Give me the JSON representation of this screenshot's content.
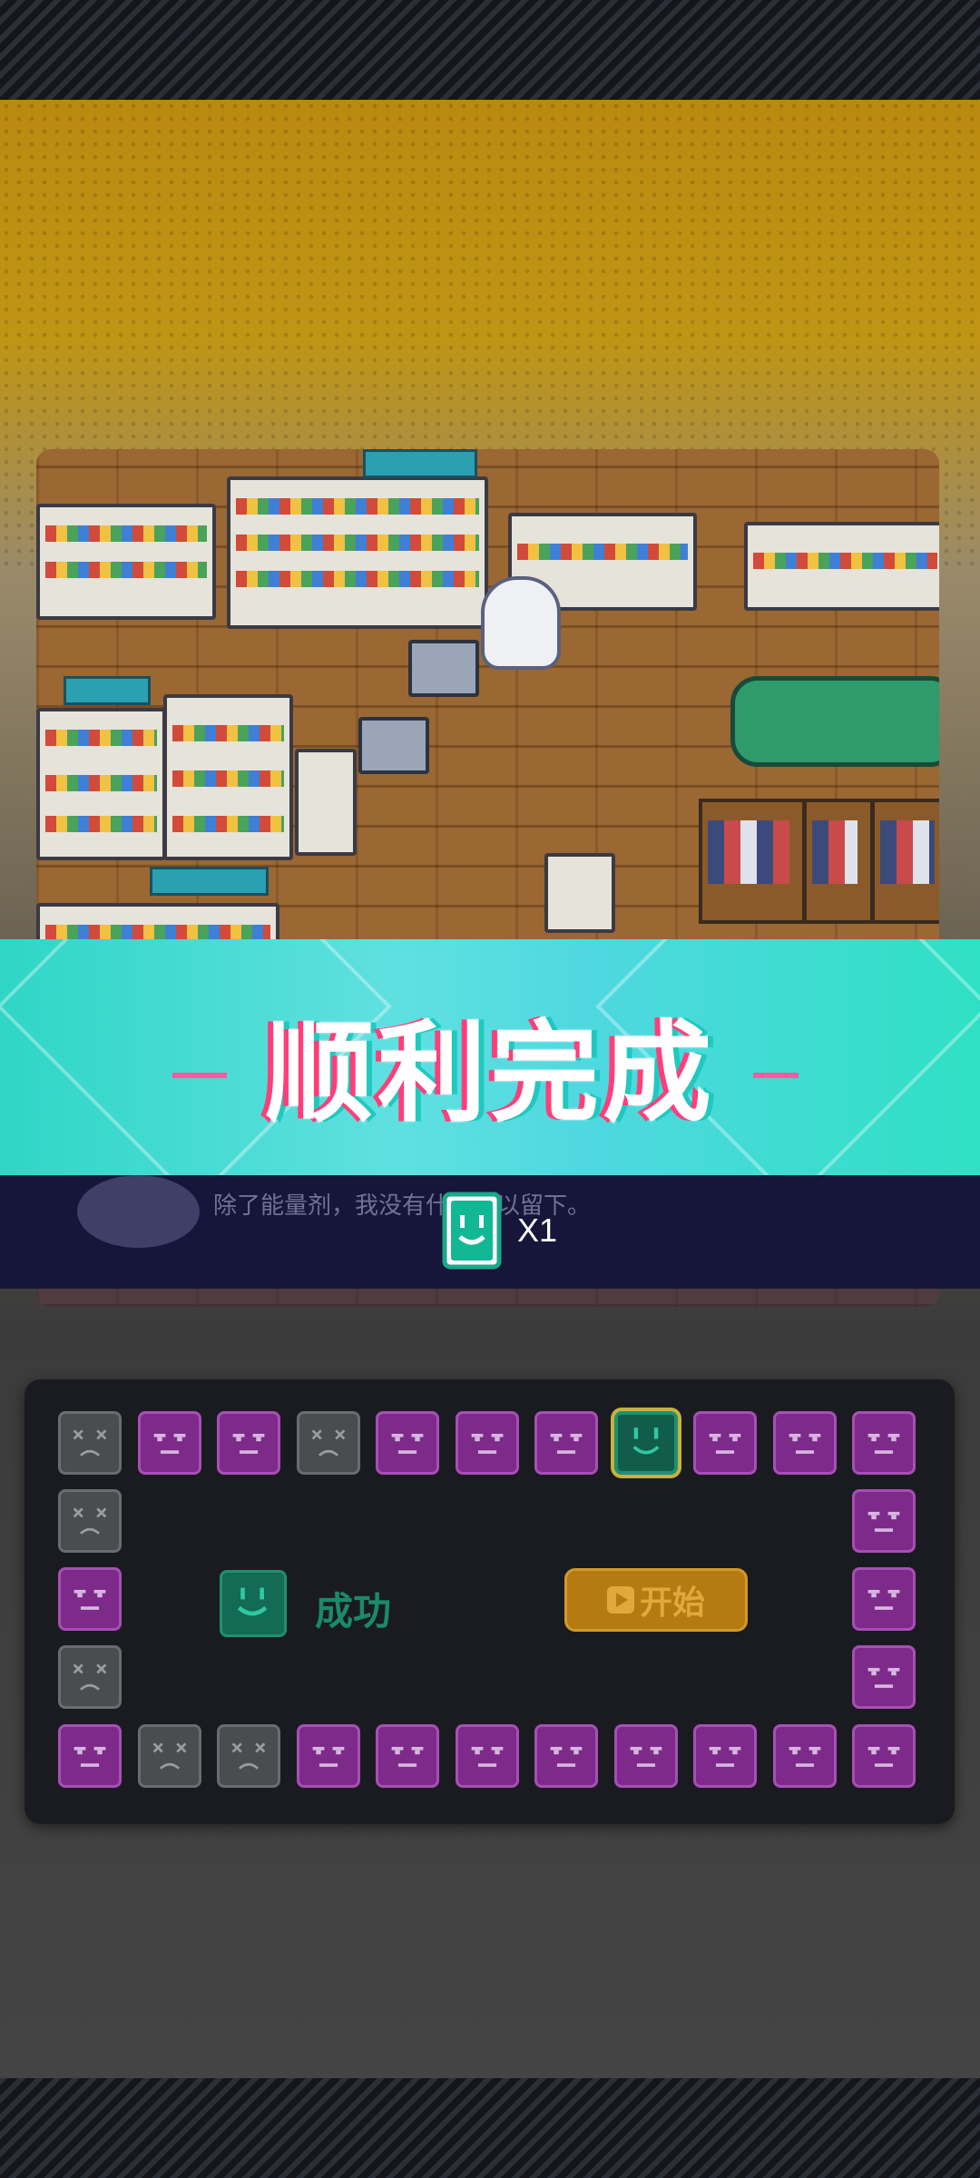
{
  "banner": {
    "title": "顺利完成"
  },
  "dialog": {
    "text": "除了能量剂，我没有什么可以留下。"
  },
  "reward": {
    "icon": "smile-card-icon",
    "count": "X1"
  },
  "board": {
    "top_row": [
      "dead",
      "bad",
      "bad",
      "dead",
      "bad",
      "bad",
      "bad",
      "good",
      "bad",
      "bad",
      "bad"
    ],
    "left_col": [
      "dead",
      "bad",
      "dead"
    ],
    "right_col": [
      "bad",
      "bad",
      "bad"
    ],
    "bottom_row": [
      "bad",
      "dead",
      "dead",
      "bad",
      "bad",
      "bad",
      "bad",
      "bad",
      "bad",
      "bad",
      "bad"
    ],
    "success_label": "成功",
    "start_label": "开始"
  },
  "colors": {
    "bad": "#7d2a8a",
    "dead": "#4a4c50",
    "good": "#115c4a",
    "accent": "#2fd6c6",
    "start": "#b57a12"
  }
}
